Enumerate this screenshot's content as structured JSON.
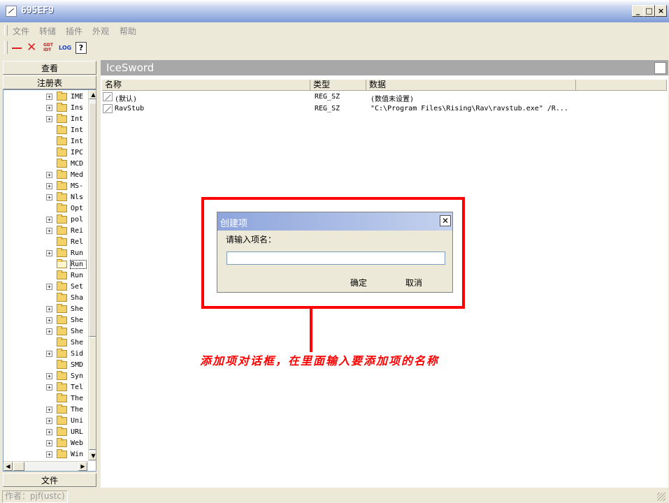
{
  "window": {
    "title": "695EF9"
  },
  "menu": [
    "文件",
    "转储",
    "插件",
    "外观",
    "帮助"
  ],
  "toolbar": {
    "gdt_idt": "GDT\nIDT",
    "log": "LOG",
    "help_glyph": "?"
  },
  "left_panel": {
    "view_tab": "查看",
    "registry_tab": "注册表",
    "file_tab": "文件",
    "tree_items": [
      {
        "label": "IME",
        "expander": true
      },
      {
        "label": "Ins",
        "expander": true
      },
      {
        "label": "Int",
        "expander": true
      },
      {
        "label": "Int",
        "expander": false
      },
      {
        "label": "Int",
        "expander": false
      },
      {
        "label": "IPC",
        "expander": false
      },
      {
        "label": "MCD",
        "expander": false
      },
      {
        "label": "Med",
        "expander": true
      },
      {
        "label": "MS-",
        "expander": true
      },
      {
        "label": "Nls",
        "expander": true
      },
      {
        "label": "Opt",
        "expander": false
      },
      {
        "label": "pol",
        "expander": true
      },
      {
        "label": "Rei",
        "expander": true
      },
      {
        "label": "Rel",
        "expander": false
      },
      {
        "label": "Run",
        "expander": true
      },
      {
        "label": "Run",
        "expander": false,
        "selected": true
      },
      {
        "label": "Run",
        "expander": false
      },
      {
        "label": "Set",
        "expander": true
      },
      {
        "label": "Sha",
        "expander": false
      },
      {
        "label": "She",
        "expander": true
      },
      {
        "label": "She",
        "expander": true
      },
      {
        "label": "She",
        "expander": true
      },
      {
        "label": "She",
        "expander": false
      },
      {
        "label": "Sid",
        "expander": true
      },
      {
        "label": "SMD",
        "expander": false
      },
      {
        "label": "Syn",
        "expander": true
      },
      {
        "label": "Tel",
        "expander": true
      },
      {
        "label": "The",
        "expander": false
      },
      {
        "label": "The",
        "expander": true
      },
      {
        "label": "Uni",
        "expander": true
      },
      {
        "label": "URL",
        "expander": true
      },
      {
        "label": "Web",
        "expander": true
      },
      {
        "label": "Win",
        "expander": true
      }
    ]
  },
  "main": {
    "header": "IceSword",
    "columns": [
      "名称",
      "类型",
      "数据"
    ],
    "rows": [
      {
        "name": "(默认)",
        "type": "REG_SZ",
        "data": "(数值未设置)"
      },
      {
        "name": "RavStub",
        "type": "REG_SZ",
        "data": "\"C:\\Program Files\\Rising\\Rav\\ravstub.exe\" /R..."
      }
    ]
  },
  "dialog": {
    "title": "创建项",
    "prompt": "请输入项名：",
    "input_value": "",
    "ok_label": "确定",
    "cancel_label": "取消",
    "close_glyph": "✕"
  },
  "annotation": "添加项对话框，在里面输入要添加项的名称",
  "status": {
    "author": "作者：pjf(ustc)"
  },
  "colors": {
    "highlight_red": "#ff0000",
    "title_blue": "#7f9cd8"
  }
}
